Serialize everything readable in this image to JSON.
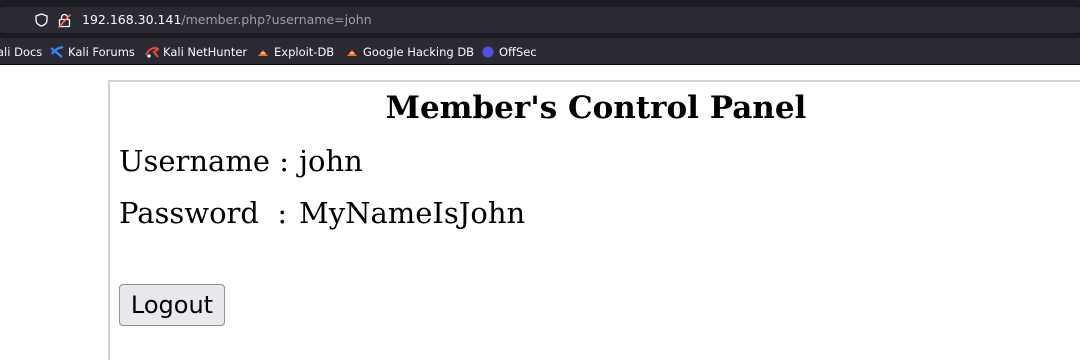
{
  "browser": {
    "url_host": "192.168.30.141",
    "url_path": "/member.php?username=john",
    "bookmarks": [
      {
        "label": "ali Docs",
        "icon": "kali-docs-icon"
      },
      {
        "label": "Kali Forums",
        "icon": "kali-forums-icon"
      },
      {
        "label": "Kali NetHunter",
        "icon": "kali-nethunter-icon"
      },
      {
        "label": "Exploit-DB",
        "icon": "exploit-db-icon"
      },
      {
        "label": "Google Hacking DB",
        "icon": "google-hacking-db-icon"
      },
      {
        "label": "OffSec",
        "icon": "offsec-icon"
      }
    ]
  },
  "panel": {
    "title": "Member's Control Panel",
    "username_label": "Username",
    "separator": ":",
    "username_value": "john",
    "password_label": "Password",
    "password_value": "MyNameIsJohn",
    "logout_label": "Logout"
  },
  "colors": {
    "toolbar_bg": "#2b2a33",
    "chrome_bg": "#1c1b22",
    "page_bg": "#ffffff",
    "panel_border": "#d3d3d3",
    "button_bg": "#e9e9ed"
  }
}
